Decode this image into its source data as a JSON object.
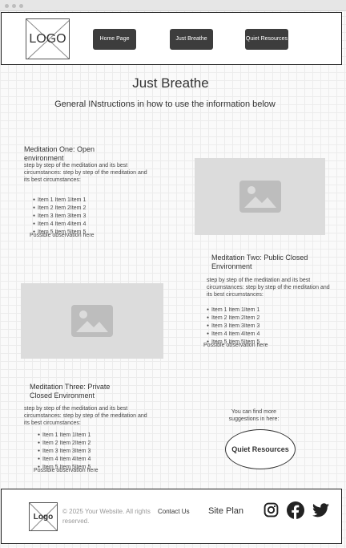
{
  "header": {
    "logo_text": "LOGO",
    "nav": [
      {
        "label": "Home Page"
      },
      {
        "label": "Just Breathe"
      },
      {
        "label": "Quiet Resources"
      }
    ]
  },
  "page": {
    "title": "Just Breathe",
    "subtitle": "General INstructions in how to use the information below"
  },
  "sections": [
    {
      "title": "Meditation One: Open environment",
      "body": "step by step of the meditation and its best circumstances: step by step of the meditation and its best circumstances:",
      "items": [
        "Item 1 Item 1Item 1",
        "Item 2 Item 2Item 2",
        "Item 3 Item 3Item 3",
        "Item 4 Item 4Item 4",
        "Item 5 Item 5Item 5"
      ],
      "observation": "Possible observation here"
    },
    {
      "title": "Meditation Two: Public Closed Environment",
      "body": "step by step of the meditation and its best circumstances: step by step of the meditation and its best circumstances:",
      "items": [
        "Item 1 Item 1Item 1",
        "Item 2 Item 2Item 2",
        "Item 3 Item 3Item 3",
        "Item 4 Item 4Item 4",
        "Item 5 Item 5Item 5"
      ],
      "observation": "Possible observation here"
    },
    {
      "title": "Meditation Three: Private Closed Environment",
      "body": "step by step of the meditation and its best circumstances: step by step of the meditation and its best circumstances:",
      "items": [
        "Item 1 Item 1Item 1",
        "Item 2 Item 2Item 2",
        "Item 3 Item 3Item 3",
        "Item 4 Item 4Item 4",
        "Item 5 Item 5Item 5"
      ],
      "observation": "Possible observation here"
    }
  ],
  "resources": {
    "hint": "You can find more suggestions in here:",
    "button_label": "Quiet Resources"
  },
  "footer": {
    "logo_text": "Logo",
    "copyright": "© 2025 Your Website. All rights reserved.",
    "contact": "Contact Us",
    "site_plan": "Site Plan",
    "social_icons": [
      "instagram-icon",
      "facebook-icon",
      "twitter-icon"
    ]
  },
  "colors": {
    "button_bg": "#3d3d3d",
    "placeholder_bg": "#dcdcdc",
    "placeholder_icon": "#bdbdbd"
  }
}
